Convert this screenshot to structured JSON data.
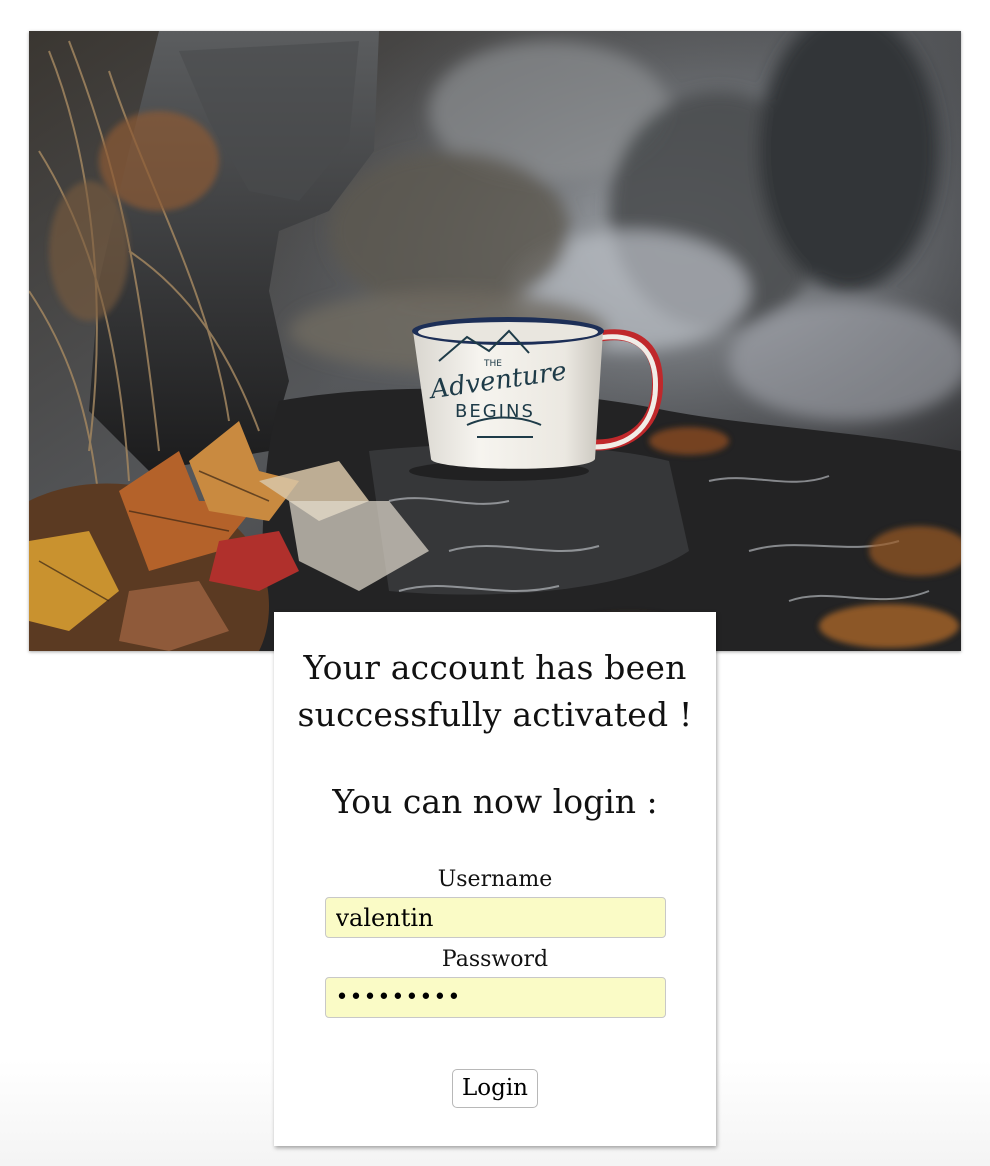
{
  "hero_image": {
    "alt": "Enamel mug on a wet rock by a waterfall",
    "mug_print_line1": "THE",
    "mug_print_line2": "Adventure",
    "mug_print_line3": "BEGINS"
  },
  "card": {
    "headline_line1": "Your account has been",
    "headline_line2": "successfully activated !",
    "subheadline": "You can now login :"
  },
  "form": {
    "username_label": "Username",
    "username_value": "valentin",
    "password_label": "Password",
    "password_value": "•••••••••",
    "login_button": "Login"
  },
  "colors": {
    "input_background": "#fafbc6",
    "mug_rim": "#1d2f57",
    "mug_handle": "#c0282b"
  }
}
